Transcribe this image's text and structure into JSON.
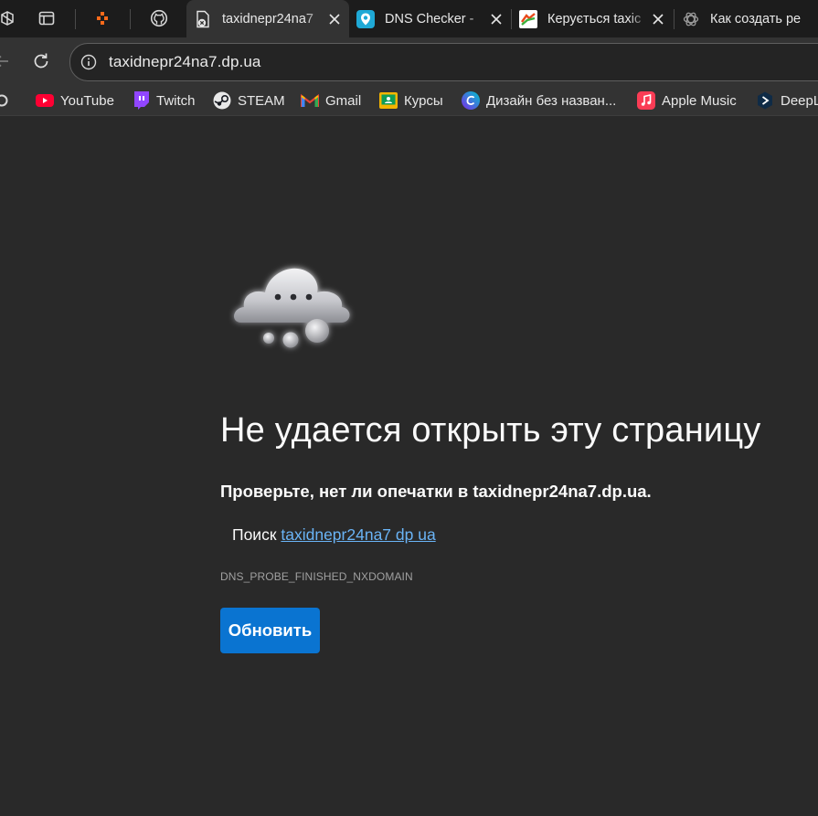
{
  "tabs": [
    {
      "title": "taxidnepr24na7",
      "active": true,
      "favicon": "broken-page-icon"
    },
    {
      "title": "DNS Checker -",
      "active": false,
      "favicon": "dns-checker-icon"
    },
    {
      "title": "Керується taxic",
      "active": false,
      "favicon": "keruetsya-icon"
    },
    {
      "title": "Как создать ре",
      "active": false,
      "favicon": "chatgpt-icon"
    }
  ],
  "address_bar": {
    "url": "taxidnepr24na7.dp.ua"
  },
  "bookmarks": [
    {
      "label": "YouTube",
      "icon": "youtube-icon"
    },
    {
      "label": "Twitch",
      "icon": "twitch-icon"
    },
    {
      "label": "STEAM",
      "icon": "steam-icon"
    },
    {
      "label": "Gmail",
      "icon": "gmail-icon"
    },
    {
      "label": "Курсы",
      "icon": "classroom-icon"
    },
    {
      "label": "Дизайн без назван...",
      "icon": "canva-icon"
    },
    {
      "label": "Apple Music",
      "icon": "apple-music-icon"
    },
    {
      "label": "DeepL",
      "icon": "deepl-icon"
    }
  ],
  "error_page": {
    "heading": "Не удается открыть эту страницу",
    "subtitle": "Проверьте, нет ли опечатки в taxidnepr24na7.dp.ua.",
    "search_prefix": "Поиск",
    "search_link": "taxidnepr24na7 dp ua",
    "error_code": "DNS_PROBE_FINISHED_NXDOMAIN",
    "reload_button": "Обновить"
  },
  "colors": {
    "background": "#292929",
    "accent": "#0a74d1",
    "link": "#6ab4f6"
  }
}
